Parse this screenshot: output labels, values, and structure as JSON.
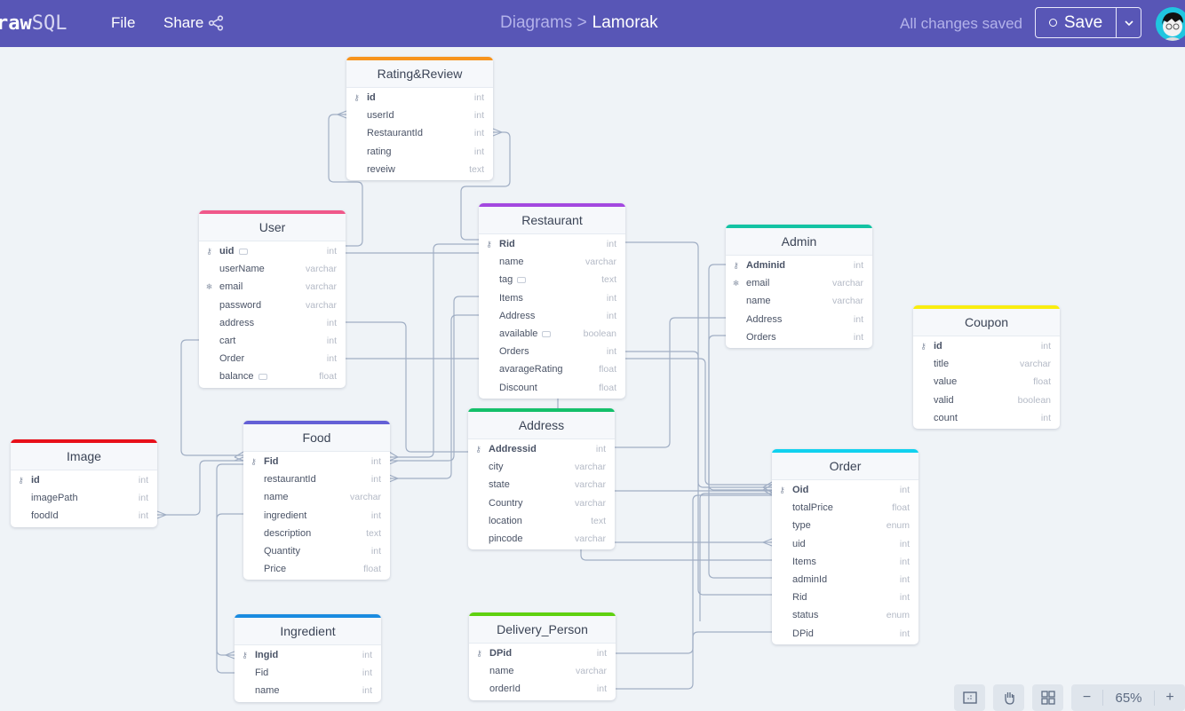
{
  "header": {
    "logo_bold": "raw",
    "logo_light": "SQL",
    "menu_file": "File",
    "menu_share": "Share",
    "share_icon": "share-icon",
    "breadcrumb_parent": "Diagrams >",
    "breadcrumb_current": "Lamorak",
    "status": "All changes saved",
    "save_label": "Save",
    "save_dropdown_icon": "chevron-down-icon",
    "avatar": "user-avatar"
  },
  "tables": [
    {
      "name": "Rating&Review",
      "color": "#f7941d",
      "columns": [
        {
          "name": "id",
          "type": "int",
          "pk": true
        },
        {
          "name": "userId",
          "type": "int"
        },
        {
          "name": "RestaurantId",
          "type": "int"
        },
        {
          "name": "rating",
          "type": "int"
        },
        {
          "name": "reveiw",
          "type": "text"
        }
      ]
    },
    {
      "name": "User",
      "color": "#f0588a",
      "columns": [
        {
          "name": "uid",
          "type": "int",
          "pk": true,
          "note": true
        },
        {
          "name": "userName",
          "type": "varchar"
        },
        {
          "name": "email",
          "type": "varchar",
          "unique": true
        },
        {
          "name": "password",
          "type": "varchar"
        },
        {
          "name": "address",
          "type": "int"
        },
        {
          "name": "cart",
          "type": "int"
        },
        {
          "name": "Order",
          "type": "int"
        },
        {
          "name": "balance",
          "type": "float",
          "note": true
        }
      ]
    },
    {
      "name": "Restaurant",
      "color": "#a348e0",
      "columns": [
        {
          "name": "Rid",
          "type": "int",
          "pk": true
        },
        {
          "name": "name",
          "type": "varchar"
        },
        {
          "name": "tag",
          "type": "text",
          "note": true
        },
        {
          "name": "Items",
          "type": "int"
        },
        {
          "name": "Address",
          "type": "int"
        },
        {
          "name": "available",
          "type": "boolean",
          "note": true
        },
        {
          "name": "Orders",
          "type": "int"
        },
        {
          "name": "avarageRating",
          "type": "float"
        },
        {
          "name": "Discount",
          "type": "float"
        }
      ]
    },
    {
      "name": "Admin",
      "color": "#13c3a3",
      "columns": [
        {
          "name": "Adminid",
          "type": "int",
          "pk": true
        },
        {
          "name": "email",
          "type": "varchar",
          "unique": true
        },
        {
          "name": "name",
          "type": "varchar"
        },
        {
          "name": "Address",
          "type": "int"
        },
        {
          "name": "Orders",
          "type": "int"
        }
      ]
    },
    {
      "name": "Coupon",
      "color": "#f9ed10",
      "columns": [
        {
          "name": "id",
          "type": "int",
          "pk": true
        },
        {
          "name": "title",
          "type": "varchar"
        },
        {
          "name": "value",
          "type": "float"
        },
        {
          "name": "valid",
          "type": "boolean"
        },
        {
          "name": "count",
          "type": "int"
        }
      ]
    },
    {
      "name": "Image",
      "color": "#e8101a",
      "columns": [
        {
          "name": "id",
          "type": "int",
          "pk": true
        },
        {
          "name": "imagePath",
          "type": "int"
        },
        {
          "name": "foodId",
          "type": "int"
        }
      ]
    },
    {
      "name": "Food",
      "color": "#6460d6",
      "columns": [
        {
          "name": "Fid",
          "type": "int",
          "pk": true
        },
        {
          "name": "restaurantId",
          "type": "int"
        },
        {
          "name": "name",
          "type": "varchar"
        },
        {
          "name": "ingredient",
          "type": "int"
        },
        {
          "name": "description",
          "type": "text"
        },
        {
          "name": "Quantity",
          "type": "int"
        },
        {
          "name": "Price",
          "type": "float"
        }
      ]
    },
    {
      "name": "Address",
      "color": "#14c06a",
      "columns": [
        {
          "name": "Addressid",
          "type": "int",
          "pk": true
        },
        {
          "name": "city",
          "type": "varchar"
        },
        {
          "name": "state",
          "type": "varchar"
        },
        {
          "name": "Country",
          "type": "varchar"
        },
        {
          "name": "location",
          "type": "text"
        },
        {
          "name": "pincode",
          "type": "varchar"
        }
      ]
    },
    {
      "name": "Order",
      "color": "#10d1ef",
      "columns": [
        {
          "name": "Oid",
          "type": "int",
          "pk": true
        },
        {
          "name": "totalPrice",
          "type": "float"
        },
        {
          "name": "type",
          "type": "enum"
        },
        {
          "name": "uid",
          "type": "int"
        },
        {
          "name": "Items",
          "type": "int"
        },
        {
          "name": "adminId",
          "type": "int"
        },
        {
          "name": "Rid",
          "type": "int"
        },
        {
          "name": "status",
          "type": "enum"
        },
        {
          "name": "DPid",
          "type": "int"
        }
      ]
    },
    {
      "name": "Ingredient",
      "color": "#1a8be0",
      "columns": [
        {
          "name": "Ingid",
          "type": "int",
          "pk": true
        },
        {
          "name": "Fid",
          "type": "int"
        },
        {
          "name": "name",
          "type": "int"
        }
      ]
    },
    {
      "name": "Delivery_Person",
      "color": "#5fd110",
      "columns": [
        {
          "name": "DPid",
          "type": "int",
          "pk": true
        },
        {
          "name": "name",
          "type": "varchar"
        },
        {
          "name": "orderId",
          "type": "int"
        }
      ]
    }
  ],
  "toolbar": {
    "minimap_icon": "minimap-icon",
    "hand_icon": "hand-icon",
    "grid_icon": "grid-icon",
    "zoom_out": "−",
    "zoom_level": "65%",
    "zoom_in": "+"
  }
}
